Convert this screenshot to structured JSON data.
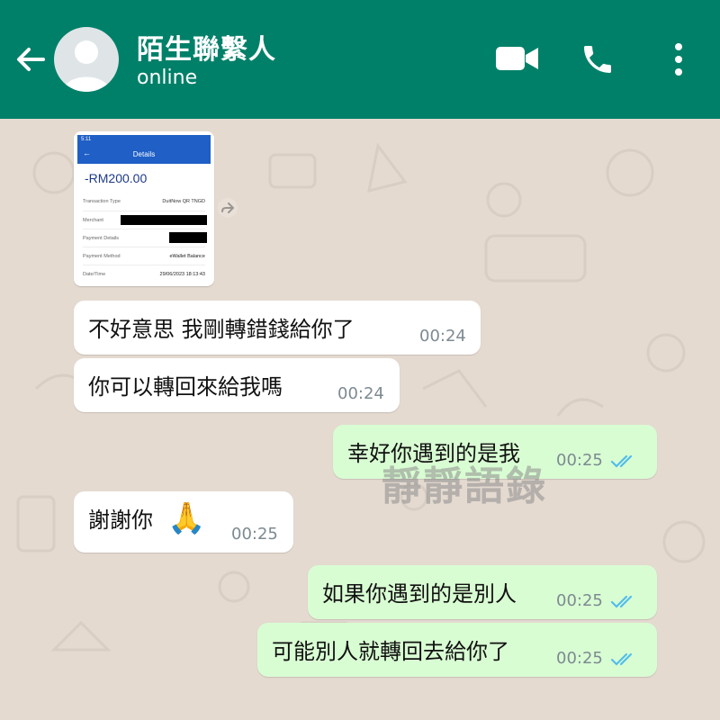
{
  "header": {
    "contact_name": "陌生聯繫人",
    "status": "online",
    "bg_color": "#008069"
  },
  "image_message": {
    "screenshot": {
      "time": "5:11",
      "title": "Details",
      "amount": "-RM200.00",
      "rows": [
        {
          "label": "Transaction Type",
          "value": "DuitNow QR TNGD"
        },
        {
          "label": "Merchant",
          "value": ""
        },
        {
          "label": "Payment Details",
          "value": ""
        },
        {
          "label": "Payment Method",
          "value": "eWallet Balance"
        },
        {
          "label": "Date/Time",
          "value": "29/06/2023 18:13:43"
        }
      ]
    }
  },
  "messages": [
    {
      "direction": "incoming",
      "text": "不好意思 我剛轉錯錢給你了",
      "time": "00:24"
    },
    {
      "direction": "incoming",
      "text": "你可以轉回來給我嗎",
      "time": "00:24"
    },
    {
      "direction": "outgoing",
      "text": "幸好你遇到的是我",
      "time": "00:25",
      "status": "read"
    },
    {
      "direction": "incoming",
      "text": "謝謝你",
      "emoji": "🙏",
      "time": "00:25"
    },
    {
      "direction": "outgoing",
      "text": "如果你遇到的是別人",
      "time": "00:25",
      "status": "read"
    },
    {
      "direction": "outgoing",
      "text": "可能別人就轉回去給你了",
      "time": "00:25",
      "status": "read"
    }
  ],
  "watermark": "靜靜語錄",
  "colors": {
    "outgoing_bubble": "#d9fdd3",
    "incoming_bubble": "#ffffff",
    "read_check": "#53bdeb"
  }
}
